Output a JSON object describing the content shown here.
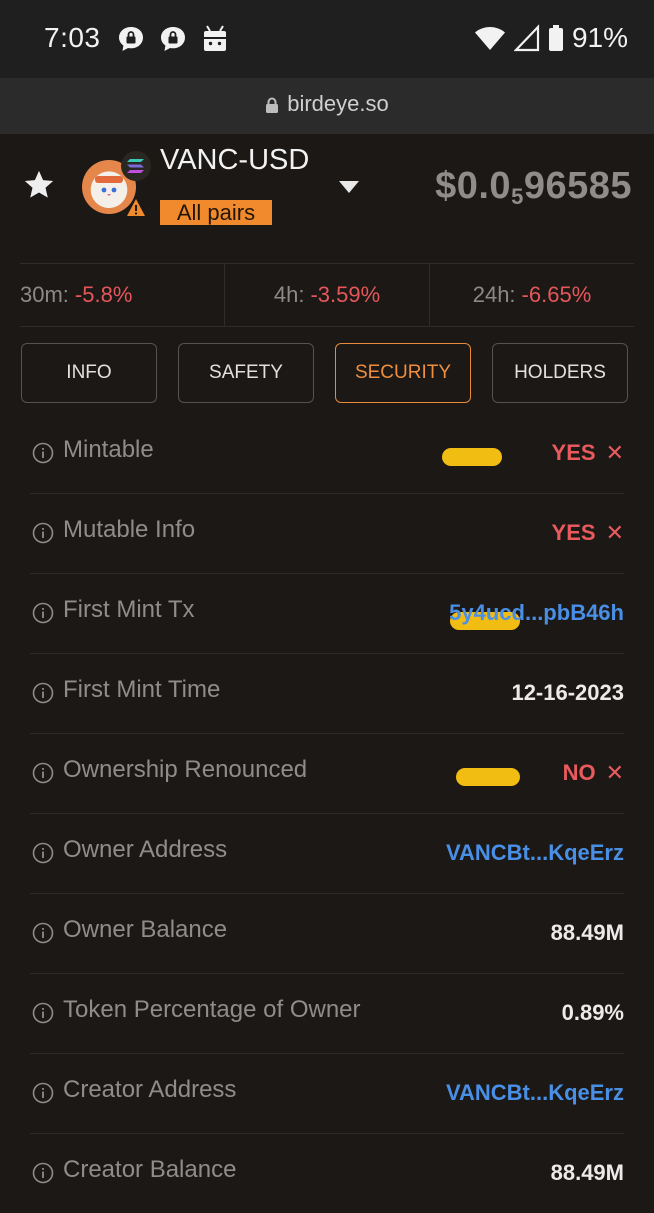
{
  "status_bar": {
    "time": "7:03",
    "battery": "91%",
    "icons": [
      "chat-bubble-lock-icon",
      "chat-bubble-lock-icon",
      "android-icon",
      "wifi-icon",
      "signal-icon",
      "battery-icon"
    ]
  },
  "browser": {
    "url": "birdeye.so"
  },
  "token": {
    "pair": "VANC-USD",
    "pairs_label": "All pairs",
    "price_prefix": "$0.0",
    "price_sub": "5",
    "price_rest": "96585"
  },
  "changes": [
    {
      "period": "30m:",
      "value": "-5.8%"
    },
    {
      "period": "4h:",
      "value": "-3.59%"
    },
    {
      "period": "24h:",
      "value": "-6.65%"
    }
  ],
  "tabs": [
    "INFO",
    "SAFETY",
    "SECURITY",
    "HOLDERS"
  ],
  "active_tab": "SECURITY",
  "security_rows": [
    {
      "label": "Mintable",
      "value": "YES",
      "status": "bad"
    },
    {
      "label": "Mutable Info",
      "value": "YES",
      "status": "bad"
    },
    {
      "label": "First Mint Tx",
      "value": "5y4ucd...pbB46h",
      "status": "link"
    },
    {
      "label": "First Mint Time",
      "value": "12-16-2023",
      "status": "plain"
    },
    {
      "label": "Ownership Renounced",
      "value": "NO",
      "status": "bad"
    },
    {
      "label": "Owner Address",
      "value": "VANCBt...KqeErz",
      "status": "link"
    },
    {
      "label": "Owner Balance",
      "value": "88.49M",
      "status": "plain"
    },
    {
      "label": "Token Percentage of Owner",
      "value": "0.89%",
      "status": "plain"
    },
    {
      "label": "Creator Address",
      "value": "VANCBt...KqeErz",
      "status": "link"
    },
    {
      "label": "Creator Balance",
      "value": "88.49M",
      "status": "plain"
    }
  ],
  "colors": {
    "accent": "#ef8e3e",
    "negative": "#e5565a",
    "link": "#4a8fe6",
    "background": "#1b1816"
  }
}
